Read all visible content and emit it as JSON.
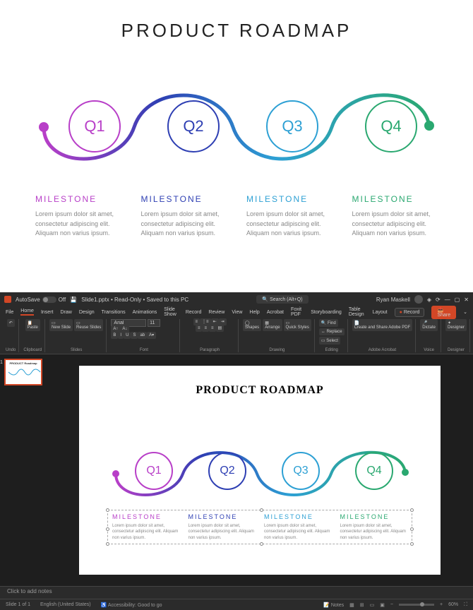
{
  "diagram": {
    "title": "PRODUCT ROADMAP",
    "quarters": [
      "Q1",
      "Q2",
      "Q3",
      "Q4"
    ],
    "milestone_label": "MILESTONE",
    "lorem": "Lorem ipsum dolor sit amet, consectetur adipiscing elit. Aliquam non varius ipsum."
  },
  "ppt": {
    "autosave_label": "AutoSave",
    "autosave_state": "Off",
    "doc_title": "Slide1.pptx • Read-Only • Saved to this PC",
    "search_placeholder": "Search (Alt+Q)",
    "user": "Ryan Maskell",
    "menu": [
      "File",
      "Home",
      "Insert",
      "Draw",
      "Design",
      "Transitions",
      "Animations",
      "Slide Show",
      "Record",
      "Review",
      "View",
      "Help",
      "Acrobat",
      "Foxit PDF",
      "Storyboarding",
      "Table Design",
      "Layout"
    ],
    "record_btn": "Record",
    "share_btn": "Share",
    "ribbon": {
      "undo": "Undo",
      "clipboard": "Clipboard",
      "paste": "Paste",
      "slides": "Slides",
      "new_slide": "New Slide",
      "reuse_slides": "Reuse Slides",
      "font": "Font",
      "font_name": "Arial",
      "font_size": "11",
      "paragraph": "Paragraph",
      "drawing": "Drawing",
      "shapes": "Shapes",
      "arrange": "Arrange",
      "quick_styles": "Quick Styles",
      "editing": "Editing",
      "find": "Find",
      "replace": "Replace",
      "select": "Select",
      "acrobat": "Adobe Acrobat",
      "create_share": "Create and Share Adobe PDF",
      "voice": "Voice",
      "dictate": "Dictate",
      "designer": "Designer"
    },
    "slide": {
      "title": "PRODUCT ROADMAP",
      "quarters": [
        "Q1",
        "Q2",
        "Q3",
        "Q4"
      ],
      "milestone_label": "MILESTONE",
      "lorem": "Lorem ipsum dolor sit amet, consectetur adipiscing elit. Aliquam non varius ipsum."
    },
    "thumb_num": "1",
    "notes_placeholder": "Click to add notes",
    "status": {
      "slide_pos": "Slide 1 of 1",
      "lang": "English (United States)",
      "accessibility": "Accessibility: Good to go",
      "notes_btn": "Notes",
      "zoom": "60%"
    }
  }
}
